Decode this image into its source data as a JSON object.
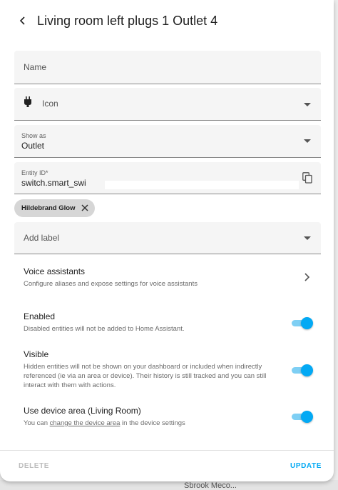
{
  "dialog": {
    "title": "Living room left plugs 1 Outlet 4"
  },
  "fields": {
    "name": {
      "placeholder": "Name"
    },
    "icon": {
      "placeholder": "Icon"
    },
    "show_as": {
      "label": "Show as",
      "value": "Outlet"
    },
    "entity_id": {
      "label": "Entity ID*",
      "value": "switch.smart_swi"
    },
    "add_label": {
      "placeholder": "Add label"
    }
  },
  "chips": [
    {
      "label": "Hildebrand Glow"
    }
  ],
  "settings": {
    "voice_assistants": {
      "title": "Voice assistants",
      "description": "Configure aliases and expose settings for voice assistants"
    },
    "enabled": {
      "title": "Enabled",
      "description": "Disabled entities will not be added to Home Assistant.",
      "on": true
    },
    "visible": {
      "title": "Visible",
      "description": "Hidden entities will not be shown on your dashboard or included when indirectly referenced (ie via an area or device). Their history is still tracked and you can still interact with them with actions.",
      "on": true
    },
    "device_area": {
      "title": "Use device area (Living Room)",
      "description_prefix": "You can ",
      "description_link": "change the device area",
      "description_suffix": " in the device settings",
      "on": true
    }
  },
  "footer": {
    "delete_label": "DELETE",
    "update_label": "UPDATE"
  },
  "background": {
    "fragment": "Sbrook Meco..."
  },
  "colors": {
    "accent": "#03a9f4",
    "toggle_track": "#7ecff4",
    "field_bg": "#f5f5f5",
    "chip_bg": "#d6d6d6"
  }
}
